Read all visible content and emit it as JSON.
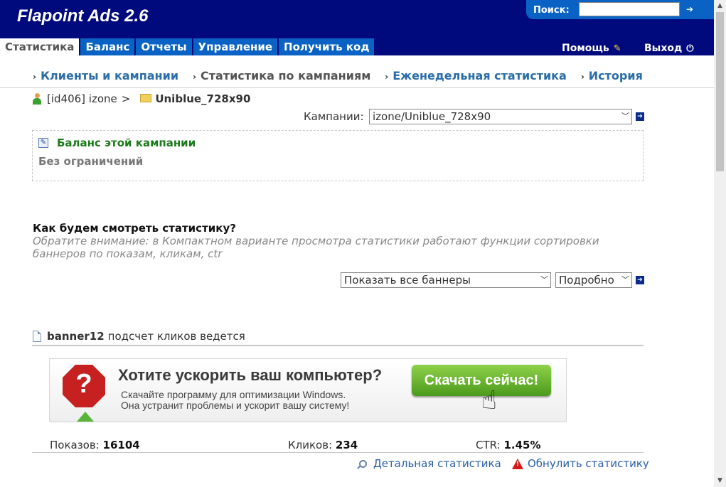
{
  "app": {
    "title": "Flapoint Ads 2.6"
  },
  "search": {
    "label": "Поиск:",
    "value": "",
    "go": "➔"
  },
  "tabs": [
    {
      "label": "Статистика",
      "active": true
    },
    {
      "label": "Баланс"
    },
    {
      "label": "Отчеты"
    },
    {
      "label": "Управление"
    },
    {
      "label": "Получить код"
    }
  ],
  "top_links": {
    "help": "Помощь",
    "logout": "Выход"
  },
  "subnav": [
    {
      "label": "Клиенты и кампании",
      "link": true
    },
    {
      "label": "Статистика по кампаниям",
      "link": false
    },
    {
      "label": "Еженедельная статистика",
      "link": true
    },
    {
      "label": "История",
      "link": true
    }
  ],
  "breadcrumb": {
    "client": "[id406] izone",
    "separator": ">",
    "campaign": "Uniblue_728x90"
  },
  "campaign_select": {
    "label": "Кампании:",
    "value": "izone/Uniblue_728x90"
  },
  "balance": {
    "title": "Баланс этой кампании",
    "value": "Без ограничений"
  },
  "view": {
    "question": "Как будем смотреть статистику?",
    "note": "Обратите внимание: в Компактном варианте просмотра статистики работают функции сортировки баннеров по показам, кликам, ctr",
    "banner_filter": "Показать все баннеры",
    "mode": "Подробно"
  },
  "banner": {
    "name": "banner12",
    "status": "подсчет кликов ведется",
    "ad": {
      "headline": "Хотите ускорить ваш компьютер?",
      "line1": "Скачайте программу для оптимизации Windows.",
      "line2": "Она устранит проблемы и ускорит вашу систему!",
      "cta": "Скачать сейчас!"
    },
    "stats": {
      "impressions_label": "Показов:",
      "impressions": "16104",
      "clicks_label": "Кликов:",
      "clicks": "234",
      "ctr_label": "CTR:",
      "ctr": "1.45%"
    },
    "links": {
      "detail": "Детальная статистика",
      "reset": "Обнулить статистику"
    }
  },
  "colors": {
    "header": "#000a7c",
    "tab": "#0a63c4",
    "link": "#2a6da8",
    "balance_title": "#1b7a1b"
  }
}
